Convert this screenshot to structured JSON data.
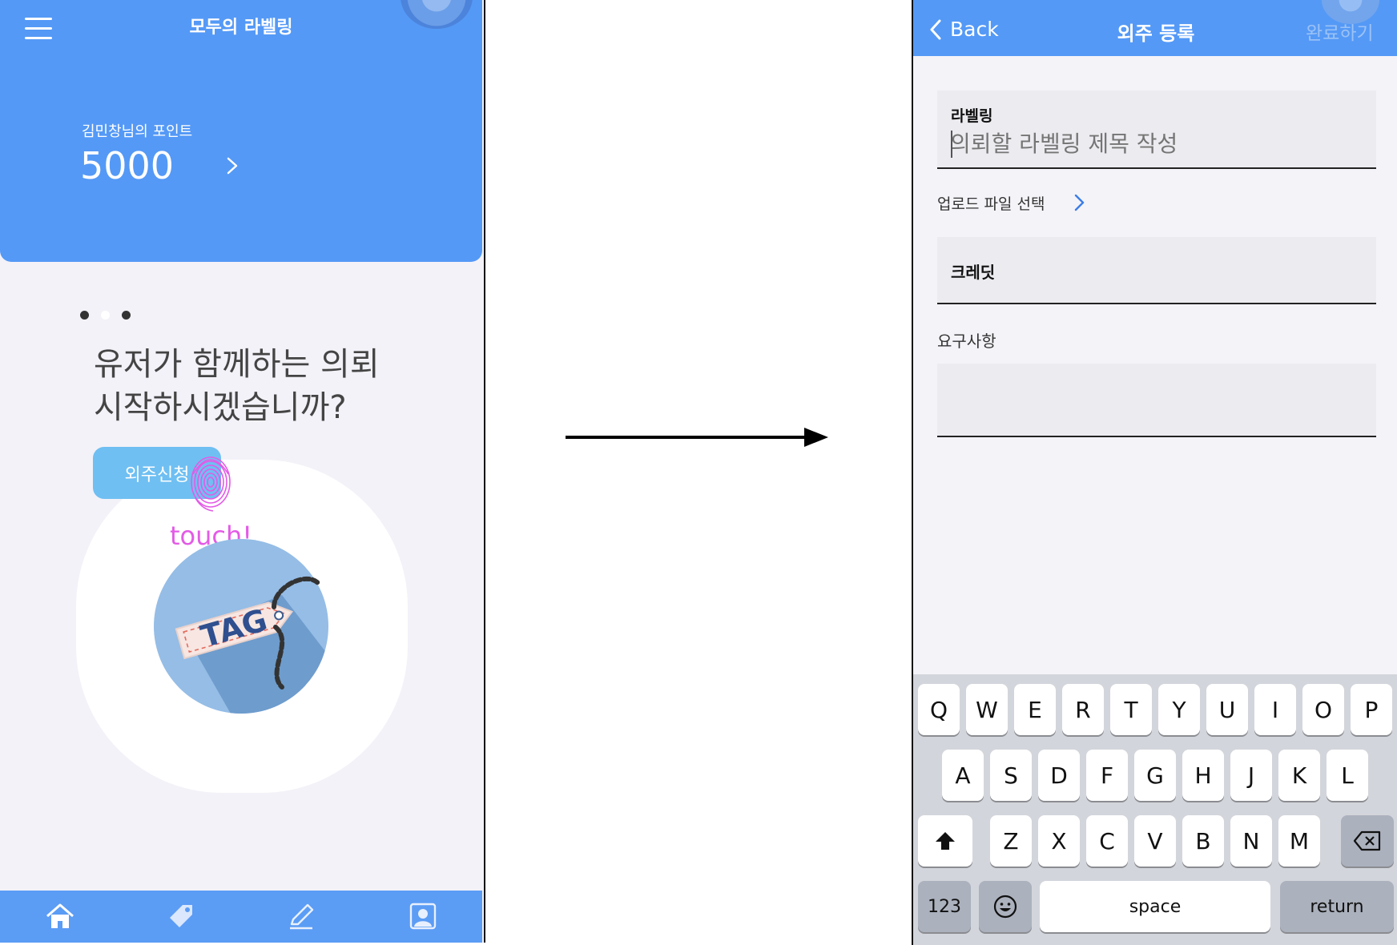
{
  "left_screen": {
    "app_title": "모두의 라벨링",
    "points_label": "김민창님의 포인트",
    "points_value": "5000",
    "headline": "유저가 함께하는 의뢰\n시작하시겠습니까?",
    "order_button_label": "외주신청",
    "touch_annotation": "touch!",
    "carousel": {
      "count": 3,
      "active_index": 0
    },
    "illustration_text": "TAG",
    "bottom_nav": [
      {
        "name": "home",
        "icon": "home-icon"
      },
      {
        "name": "tag",
        "icon": "tag-icon"
      },
      {
        "name": "edit",
        "icon": "pencil-icon"
      },
      {
        "name": "profile",
        "icon": "profile-icon"
      }
    ]
  },
  "right_screen": {
    "back_label": "Back",
    "title": "외주 등록",
    "done_label": "완료하기",
    "labeling_field": {
      "label": "라벨링",
      "placeholder": "의뢰할 라벨링 제목 작성"
    },
    "upload_label": "업로드 파일 선택",
    "credit_label": "크레딧",
    "requirements_label": "요구사항",
    "keyboard": {
      "row1": [
        "Q",
        "W",
        "E",
        "R",
        "T",
        "Y",
        "U",
        "I",
        "O",
        "P"
      ],
      "row2": [
        "A",
        "S",
        "D",
        "F",
        "G",
        "H",
        "J",
        "K",
        "L"
      ],
      "row3": [
        "Z",
        "X",
        "C",
        "V",
        "B",
        "N",
        "M"
      ],
      "numbers_label": "123",
      "space_label": "space",
      "return_label": "return"
    }
  },
  "colors": {
    "primary_blue": "#5499f6",
    "button_blue": "#6fbff2",
    "touch_pink": "#e35be6",
    "page_bg": "#f3f2f8"
  }
}
